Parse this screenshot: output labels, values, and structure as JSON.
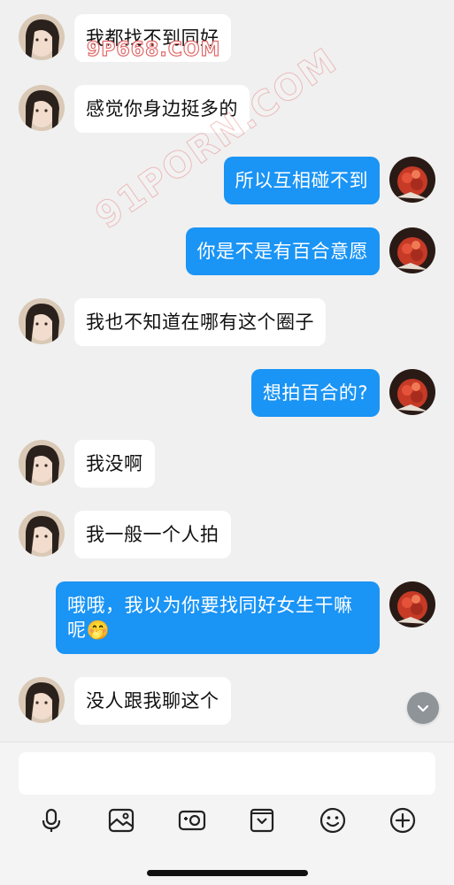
{
  "messages": [
    {
      "side": "left",
      "text": "我都找不到同好"
    },
    {
      "side": "left",
      "text": "感觉你身边挺多的"
    },
    {
      "side": "right",
      "text": "所以互相碰不到"
    },
    {
      "side": "right",
      "text": "你是不是有百合意愿"
    },
    {
      "side": "left",
      "text": "我也不知道在哪有这个圈子"
    },
    {
      "side": "right",
      "text": "想拍百合的?"
    },
    {
      "side": "left",
      "text": "我没啊"
    },
    {
      "side": "left",
      "text": "我一般一个人拍"
    },
    {
      "side": "right",
      "text": "哦哦，我以为你要找同好女生干嘛呢🤭"
    },
    {
      "side": "left",
      "text": "没人跟我聊这个"
    }
  ],
  "watermarks": {
    "top": "9P668.COM",
    "diagonal": "91PORN.COM"
  },
  "composer": {
    "input_value": "",
    "toolbar": [
      "microphone-icon",
      "image-icon",
      "camera-icon",
      "sticker-icon",
      "emoji-icon",
      "plus-icon"
    ]
  },
  "colors": {
    "outgoing_bubble": "#1a94f5",
    "incoming_bubble": "#ffffff",
    "background": "#f0f0f0"
  }
}
